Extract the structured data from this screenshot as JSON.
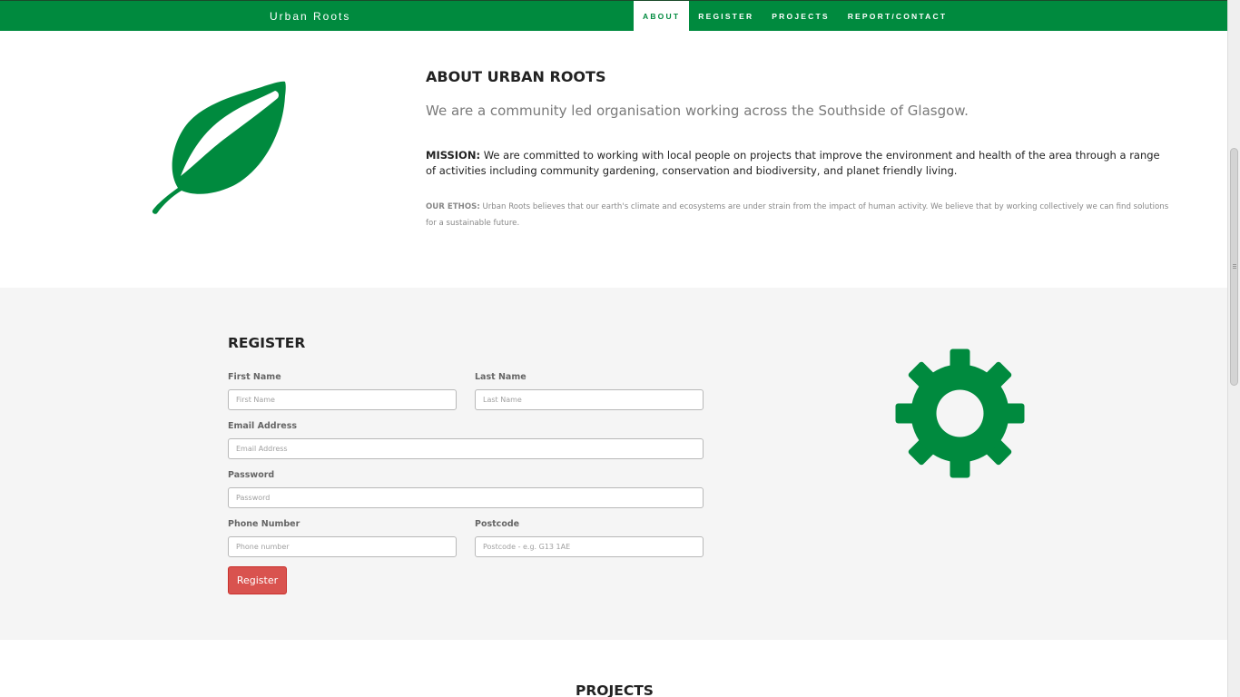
{
  "navbar": {
    "brand": "Urban Roots",
    "items": [
      {
        "label": "ABOUT",
        "active": true
      },
      {
        "label": "REGISTER",
        "active": false
      },
      {
        "label": "PROJECTS",
        "active": false
      },
      {
        "label": "REPORT/CONTACT",
        "active": false
      }
    ]
  },
  "about": {
    "icon": "leaf-icon",
    "title": "ABOUT URBAN ROOTS",
    "lead": "We are a community led organisation working across the Southside of Glasgow.",
    "mission_label": "MISSION:",
    "mission_text": " We are committed to working with local people on projects that improve the environment and health of the area through a range of activities including community gardening, conservation and biodiversity, and planet friendly living.",
    "ethos_label": "OUR ETHOS:",
    "ethos_text": " Urban Roots believes that our earth's climate and ecosystems are under strain from the impact of human activity. We believe that by working collectively we can find solutions for a sustainable future."
  },
  "register": {
    "title": "REGISTER",
    "icon": "gear-icon",
    "first_name": {
      "label": "First Name",
      "placeholder": "First Name"
    },
    "last_name": {
      "label": "Last Name",
      "placeholder": "Last Name"
    },
    "email": {
      "label": "Email Address",
      "placeholder": "Email Address"
    },
    "password": {
      "label": "Password",
      "placeholder": "Password"
    },
    "phone": {
      "label": "Phone Number",
      "placeholder": "Phone number"
    },
    "postcode": {
      "label": "Postcode",
      "placeholder": "Postcode - e.g. G13 1AE"
    },
    "submit_label": "Register"
  },
  "projects": {
    "title": "PROJECTS"
  },
  "colors": {
    "brand_green": "#008a3e",
    "register_button": "#d9534f",
    "section_gray": "#f5f5f5"
  }
}
